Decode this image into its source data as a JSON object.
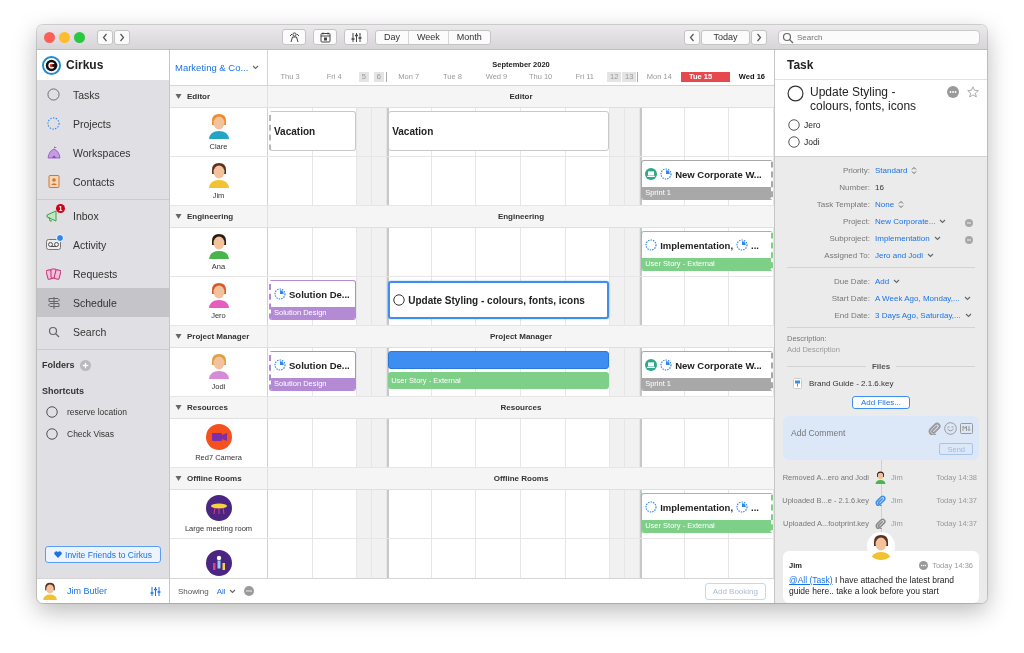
{
  "toolbar": {
    "views": [
      {
        "label": "Day",
        "selected": false
      },
      {
        "label": "Week",
        "selected": false
      },
      {
        "label": "Month",
        "selected": false
      }
    ],
    "today_button": "Today",
    "search": {
      "placeholder": "Search"
    }
  },
  "sidebar": {
    "app_name": "Cirkus",
    "nav_groups": [
      {
        "items": [
          {
            "label": "Tasks",
            "selected": false,
            "dot": false
          },
          {
            "label": "Projects",
            "selected": false,
            "dot": false
          },
          {
            "label": "Workspaces",
            "selected": false,
            "dot": false
          },
          {
            "label": "Contacts",
            "selected": false,
            "dot": false
          }
        ]
      },
      {
        "items": [
          {
            "label": "Inbox",
            "selected": false,
            "dot": false,
            "badge": "1"
          },
          {
            "label": "Activity",
            "selected": false,
            "dot": true
          },
          {
            "label": "Requests",
            "selected": false,
            "dot": false
          },
          {
            "label": "Schedule",
            "selected": true,
            "dot": false
          },
          {
            "label": "Search",
            "selected": false,
            "dot": false
          }
        ]
      }
    ],
    "folders_label": "Folders",
    "shortcuts_label": "Shortcuts",
    "shortcuts": [
      {
        "label": "reserve location",
        "checked": false
      },
      {
        "label": "Check Visas",
        "checked": false
      }
    ],
    "invite_button": "Invite Friends to Cirkus",
    "user": {
      "name": "Jim Butler"
    }
  },
  "schedule": {
    "filter": "Marketing & Co...",
    "month": "September 2020",
    "days": [
      {
        "label": "Thu 3",
        "kind": "weekday",
        "today": false,
        "selected": false
      },
      {
        "label": "Fri 4",
        "kind": "weekday",
        "today": false,
        "selected": false
      },
      {
        "label": "5",
        "kind": "weekend",
        "today": false,
        "selected": false
      },
      {
        "label": "6",
        "kind": "weekend",
        "today": false,
        "selected": false
      },
      {
        "label": "Mon 7",
        "kind": "weekday",
        "today": false,
        "selected": false
      },
      {
        "label": "Tue 8",
        "kind": "weekday",
        "today": false,
        "selected": false
      },
      {
        "label": "Wed 9",
        "kind": "weekday",
        "today": false,
        "selected": false
      },
      {
        "label": "Thu 10",
        "kind": "weekday",
        "today": false,
        "selected": false
      },
      {
        "label": "Fri 11",
        "kind": "weekday",
        "today": false,
        "selected": false
      },
      {
        "label": "12",
        "kind": "weekend",
        "today": false,
        "selected": false
      },
      {
        "label": "13",
        "kind": "weekend",
        "today": false,
        "selected": false
      },
      {
        "label": "Mon 14",
        "kind": "weekday",
        "today": false,
        "selected": false
      },
      {
        "label": "Tue 15",
        "kind": "weekday",
        "today": true,
        "selected": false
      },
      {
        "label": "Wed 16",
        "kind": "weekday",
        "today": false,
        "selected": true
      }
    ],
    "groups": [
      {
        "name": "Editor",
        "banner": "Editor",
        "expanded": true,
        "rows": [
          {
            "name": "Clare",
            "kind": "person",
            "events": [
              {
                "kind": "card",
                "title": "Vacation",
                "cut_left": true,
                "cut_right": false,
                "selected": false
              },
              {
                "kind": "card",
                "title": "Vacation",
                "cut_left": false,
                "cut_right": false,
                "selected": false
              }
            ]
          },
          {
            "name": "Jim",
            "kind": "person",
            "events": [
              {
                "kind": "card",
                "title": "New Corporate W...",
                "band": "Sprint 1",
                "color": "#a8a8a8",
                "cut_left": false,
                "cut_right": true,
                "selected": false
              }
            ]
          }
        ]
      },
      {
        "name": "Engineering",
        "banner": "Engineering",
        "expanded": true,
        "rows": [
          {
            "name": "Ana",
            "kind": "person",
            "events": [
              {
                "kind": "card",
                "title": "Implementation,",
                "more": "...",
                "band": "User Story - External",
                "color": "#7ecf88",
                "cut_left": false,
                "cut_right": true,
                "selected": false
              }
            ]
          },
          {
            "name": "Jero",
            "kind": "person",
            "events": [
              {
                "kind": "card",
                "title": "Solution De...",
                "band": "Solution Design",
                "color": "#b48ad4",
                "cut_left": true,
                "cut_right": false,
                "selected": false
              },
              {
                "kind": "card",
                "title": "Update Styling - colours, fonts, icons",
                "cut_left": false,
                "cut_right": false,
                "selected": true
              }
            ]
          }
        ]
      },
      {
        "name": "Project Manager",
        "banner": "Project Manager",
        "expanded": true,
        "rows": [
          {
            "name": "Jodi",
            "kind": "person",
            "events": [
              {
                "kind": "card",
                "title": "Solution De...",
                "band": "Solution Design",
                "color": "#b48ad4",
                "cut_left": true,
                "cut_right": false,
                "selected": false
              },
              {
                "kind": "bar",
                "band": "User Story - External",
                "color": "#7ecf88",
                "cut_left": false,
                "cut_right": false,
                "selected": true
              },
              {
                "kind": "card",
                "title": "New Corporate W...",
                "band": "Sprint 1",
                "color": "#a8a8a8",
                "cut_left": false,
                "cut_right": true,
                "selected": false
              }
            ]
          }
        ]
      },
      {
        "name": "Resources",
        "banner": "Resources",
        "expanded": true,
        "rows": [
          {
            "name": "Red7 Camera",
            "kind": "camera",
            "events": []
          }
        ]
      },
      {
        "name": "Offline Rooms",
        "banner": "Offline Rooms",
        "expanded": true,
        "rows": [
          {
            "name": "Large meeting room",
            "kind": "room",
            "events": [
              {
                "kind": "card",
                "title": "Implementation,",
                "more": "...",
                "band": "User Story - External",
                "color": "#7ecf88",
                "cut_left": false,
                "cut_right": true,
                "selected": false
              }
            ]
          },
          {
            "kind": "team",
            "events": []
          }
        ]
      }
    ],
    "showing_label": "Showing",
    "showing_value": "All",
    "add_booking": "Add Booking"
  },
  "task_panel": {
    "heading": "Task",
    "title": "Update Styling - colours, fonts, icons",
    "checked": false,
    "starred": false,
    "assignees": [
      {
        "name": "Jero",
        "checked": false
      },
      {
        "name": "Jodi",
        "checked": false
      }
    ],
    "property_groups": [
      [
        {
          "label": "Priority:",
          "value": "Standard",
          "kind": "stepper",
          "removable": false
        },
        {
          "label": "Number:",
          "value": "16",
          "kind": "text",
          "removable": false
        },
        {
          "label": "Task Template:",
          "value": "None",
          "kind": "stepper",
          "removable": false
        },
        {
          "label": "Project:",
          "value": "New Corporate...",
          "kind": "dropdown",
          "removable": true
        },
        {
          "label": "Subproject:",
          "value": "Implementation",
          "kind": "dropdown",
          "removable": true
        },
        {
          "label": "Assigned To:",
          "value": "Jero and Jodi",
          "kind": "dropdown",
          "removable": false
        }
      ],
      [
        {
          "label": "Due Date:",
          "value": "Add",
          "kind": "dropdown",
          "removable": false
        },
        {
          "label": "Start Date:",
          "value": "A Week Ago, Monday,...",
          "kind": "dropdown",
          "removable": false
        },
        {
          "label": "End Date:",
          "value": "3 Days Ago, Saturday,...",
          "kind": "dropdown",
          "removable": false
        }
      ]
    ],
    "description_label": "Description:",
    "description_placeholder": "Add Description",
    "files_heading": "Files",
    "files": [
      {
        "name": "Brand Guide - 2.1.6.key"
      }
    ],
    "add_files": "Add Files...",
    "comment": {
      "placeholder": "Add Comment",
      "send": "Send",
      "send_disabled": true
    },
    "activity": [
      {
        "text": "Removed A...ero and Jodi",
        "kind": "avatar",
        "user": "Jim",
        "time": "Today 14:38"
      },
      {
        "text": "Uploaded B...e - 2.1.6.key",
        "kind": "attachment",
        "color": "#3b8ee8",
        "user": "Jim",
        "time": "Today 14:37"
      },
      {
        "text": "Uploaded A...footprint.key",
        "kind": "attachment",
        "color": "#8a8a8a",
        "user": "Jim",
        "time": "Today 14:37"
      }
    ],
    "comments": [
      {
        "author": "Jim",
        "time": "Today 14:36",
        "mention": "@All (Task)",
        "text": "I have attached the latest brand guide here.. take a look before you start"
      }
    ]
  }
}
